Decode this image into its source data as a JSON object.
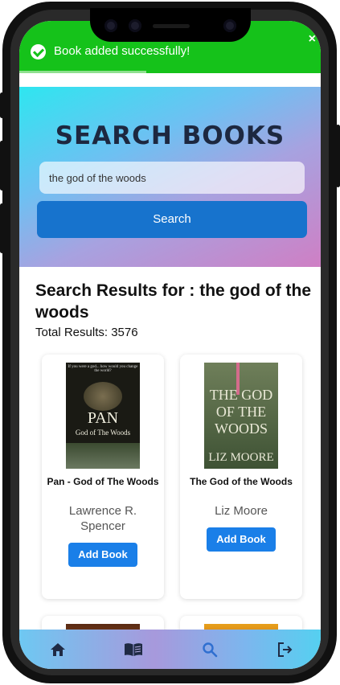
{
  "toast": {
    "message": "Book added successfully!",
    "close": "×",
    "progress": 0.42
  },
  "hero": {
    "title": "SEARCH BOOKS",
    "search_value": "the god of the woods",
    "search_button": "Search"
  },
  "results": {
    "title": "Search Results for : the god of the woods",
    "total": "Total Results: 3576"
  },
  "books": [
    {
      "title": "Pan - God of The Woods",
      "author": "Lawrence R. Spencer",
      "button": "Add Book",
      "cover": {
        "line0": "If you were a god... how would you change the world?",
        "line1": "PAN",
        "line2": "God of The Woods"
      }
    },
    {
      "title": "The God of the Woods",
      "author": "Liz Moore",
      "button": "Add Book",
      "cover": {
        "line1": "THE GOD OF THE WOODS",
        "line2": "LIZ MOORE"
      }
    }
  ],
  "nav": {
    "items": [
      {
        "icon": "home-icon"
      },
      {
        "icon": "book-icon"
      },
      {
        "icon": "search-icon",
        "active": true
      },
      {
        "icon": "logout-icon"
      }
    ]
  },
  "colors": {
    "toast": "#15c21a",
    "primary": "#1773cd",
    "add_button": "#1a7fe8"
  }
}
